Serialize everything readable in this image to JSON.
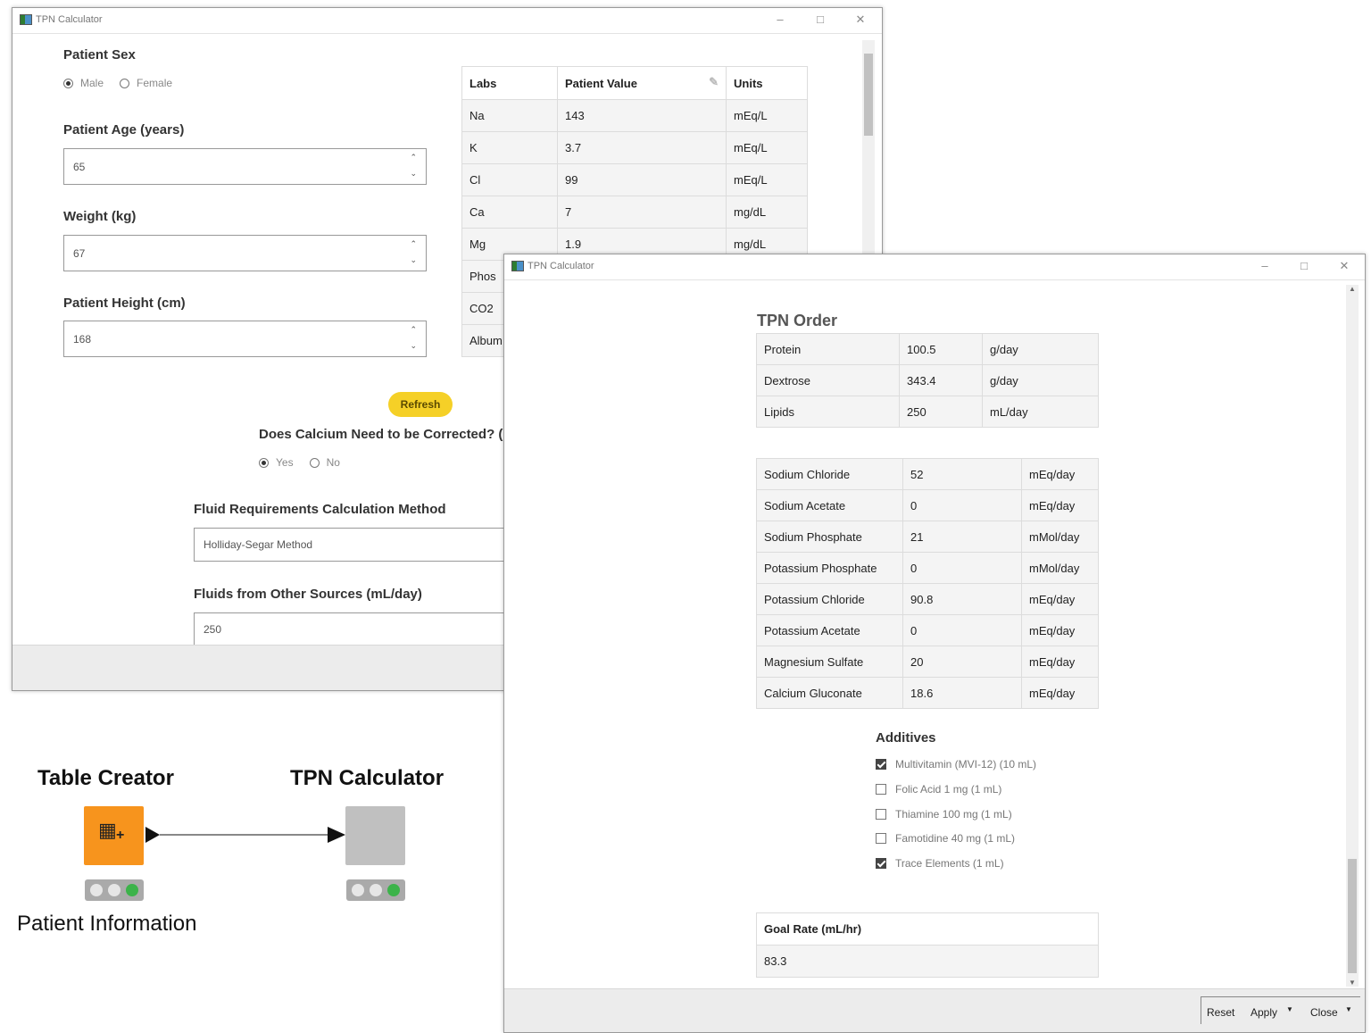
{
  "window1": {
    "title": "TPN Calculator",
    "patient_sex": {
      "label": "Patient Sex",
      "options": [
        "Male",
        "Female"
      ],
      "selected": "Male"
    },
    "age": {
      "label": "Patient Age (years)",
      "value": "65"
    },
    "weight": {
      "label": "Weight (kg)",
      "value": "67"
    },
    "height": {
      "label": "Patient Height (cm)",
      "value": "168"
    },
    "refresh_label": "Refresh",
    "calcium": {
      "label": "Does Calcium Need to be Corrected? (I",
      "options": [
        "Yes",
        "No"
      ],
      "selected": "Yes"
    },
    "fluid_method": {
      "label": "Fluid Requirements Calculation Method",
      "value": "Holliday-Segar Method"
    },
    "fluids_other": {
      "label": "Fluids from Other Sources (mL/day)",
      "value": "250"
    },
    "labs": {
      "headers": [
        "Labs",
        "Patient Value",
        "Units"
      ],
      "rows": [
        [
          "Na",
          "143",
          "mEq/L"
        ],
        [
          "K",
          "3.7",
          "mEq/L"
        ],
        [
          "Cl",
          "99",
          "mEq/L"
        ],
        [
          "Ca",
          "7",
          "mg/dL"
        ],
        [
          "Mg",
          "1.9",
          "mg/dL"
        ],
        [
          "Phos",
          "",
          ""
        ],
        [
          "CO2",
          "",
          ""
        ],
        [
          "Album",
          "",
          ""
        ]
      ]
    }
  },
  "window2": {
    "title": "TPN Calculator",
    "tpn_order_title": "TPN Order",
    "macros": [
      [
        "Protein",
        "100.5",
        "g/day"
      ],
      [
        "Dextrose",
        "343.4",
        "g/day"
      ],
      [
        "Lipids",
        "250",
        "mL/day"
      ]
    ],
    "electrolytes": [
      [
        "Sodium Chloride",
        "52",
        "mEq/day"
      ],
      [
        "Sodium Acetate",
        "0",
        "mEq/day"
      ],
      [
        "Sodium Phosphate",
        "21",
        "mMol/day"
      ],
      [
        "Potassium Phosphate",
        "0",
        "mMol/day"
      ],
      [
        "Potassium Chloride",
        "90.8",
        "mEq/day"
      ],
      [
        "Potassium Acetate",
        "0",
        "mEq/day"
      ],
      [
        "Magnesium Sulfate",
        "20",
        "mEq/day"
      ],
      [
        "Calcium Gluconate",
        "18.6",
        "mEq/day"
      ]
    ],
    "additives_title": "Additives",
    "additives": [
      {
        "label": "Multivitamin (MVI-12) (10 mL)",
        "checked": true
      },
      {
        "label": "Folic Acid 1 mg (1 mL)",
        "checked": false
      },
      {
        "label": "Thiamine 100 mg (1 mL)",
        "checked": false
      },
      {
        "label": "Famotidine 40 mg (1 mL)",
        "checked": false
      },
      {
        "label": "Trace Elements (1 mL)",
        "checked": true
      }
    ],
    "goal_rate": {
      "header": "Goal Rate (mL/hr)",
      "value": "83.3"
    },
    "footer": {
      "reset": "Reset",
      "apply": "Apply",
      "close": "Close"
    }
  },
  "workflow": {
    "node1": {
      "title": "Table Creator",
      "label": "Patient Information",
      "color": "#f7941d"
    },
    "node2": {
      "title": "TPN Calculator",
      "color": "#c0c0c0"
    },
    "status_green": "#3cb34a"
  }
}
